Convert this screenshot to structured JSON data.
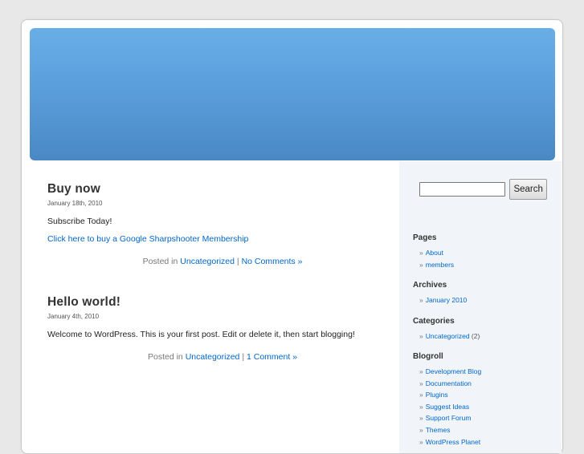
{
  "posts": [
    {
      "title": "Buy now",
      "date": "January 18th, 2010",
      "paragraphs": [
        "Subscribe Today!"
      ],
      "link_text": "Click here to buy a Google Sharpshooter Membership",
      "meta_prefix": "Posted in",
      "category": "Uncategorized",
      "separator": "|",
      "comments": "No Comments »"
    },
    {
      "title": "Hello world!",
      "date": "January 4th, 2010",
      "paragraphs": [
        "Welcome to WordPress. This is your first post. Edit or delete it, then start blogging!"
      ],
      "meta_prefix": "Posted in",
      "category": "Uncategorized",
      "separator": "|",
      "comments": "1 Comment »"
    }
  ],
  "sidebar": {
    "search": {
      "value": "",
      "button_label": "Search"
    },
    "bullet": "»",
    "pages": {
      "title": "Pages",
      "items": [
        "About",
        "members"
      ]
    },
    "archives": {
      "title": "Archives",
      "items": [
        "January 2010"
      ]
    },
    "categories": {
      "title": "Categories",
      "items": [
        {
          "label": "Uncategorized",
          "count": "(2)"
        }
      ]
    },
    "blogroll": {
      "title": "Blogroll",
      "items": [
        "Development Blog",
        "Documentation",
        "Plugins",
        "Suggest Ideas",
        "Support Forum",
        "Themes",
        "WordPress Planet"
      ]
    }
  },
  "colors": {
    "link": "#0066cc",
    "header_top": "#69aee7",
    "header_bottom": "#4a88c4",
    "sidebar_bg": "#f1f5f9"
  }
}
